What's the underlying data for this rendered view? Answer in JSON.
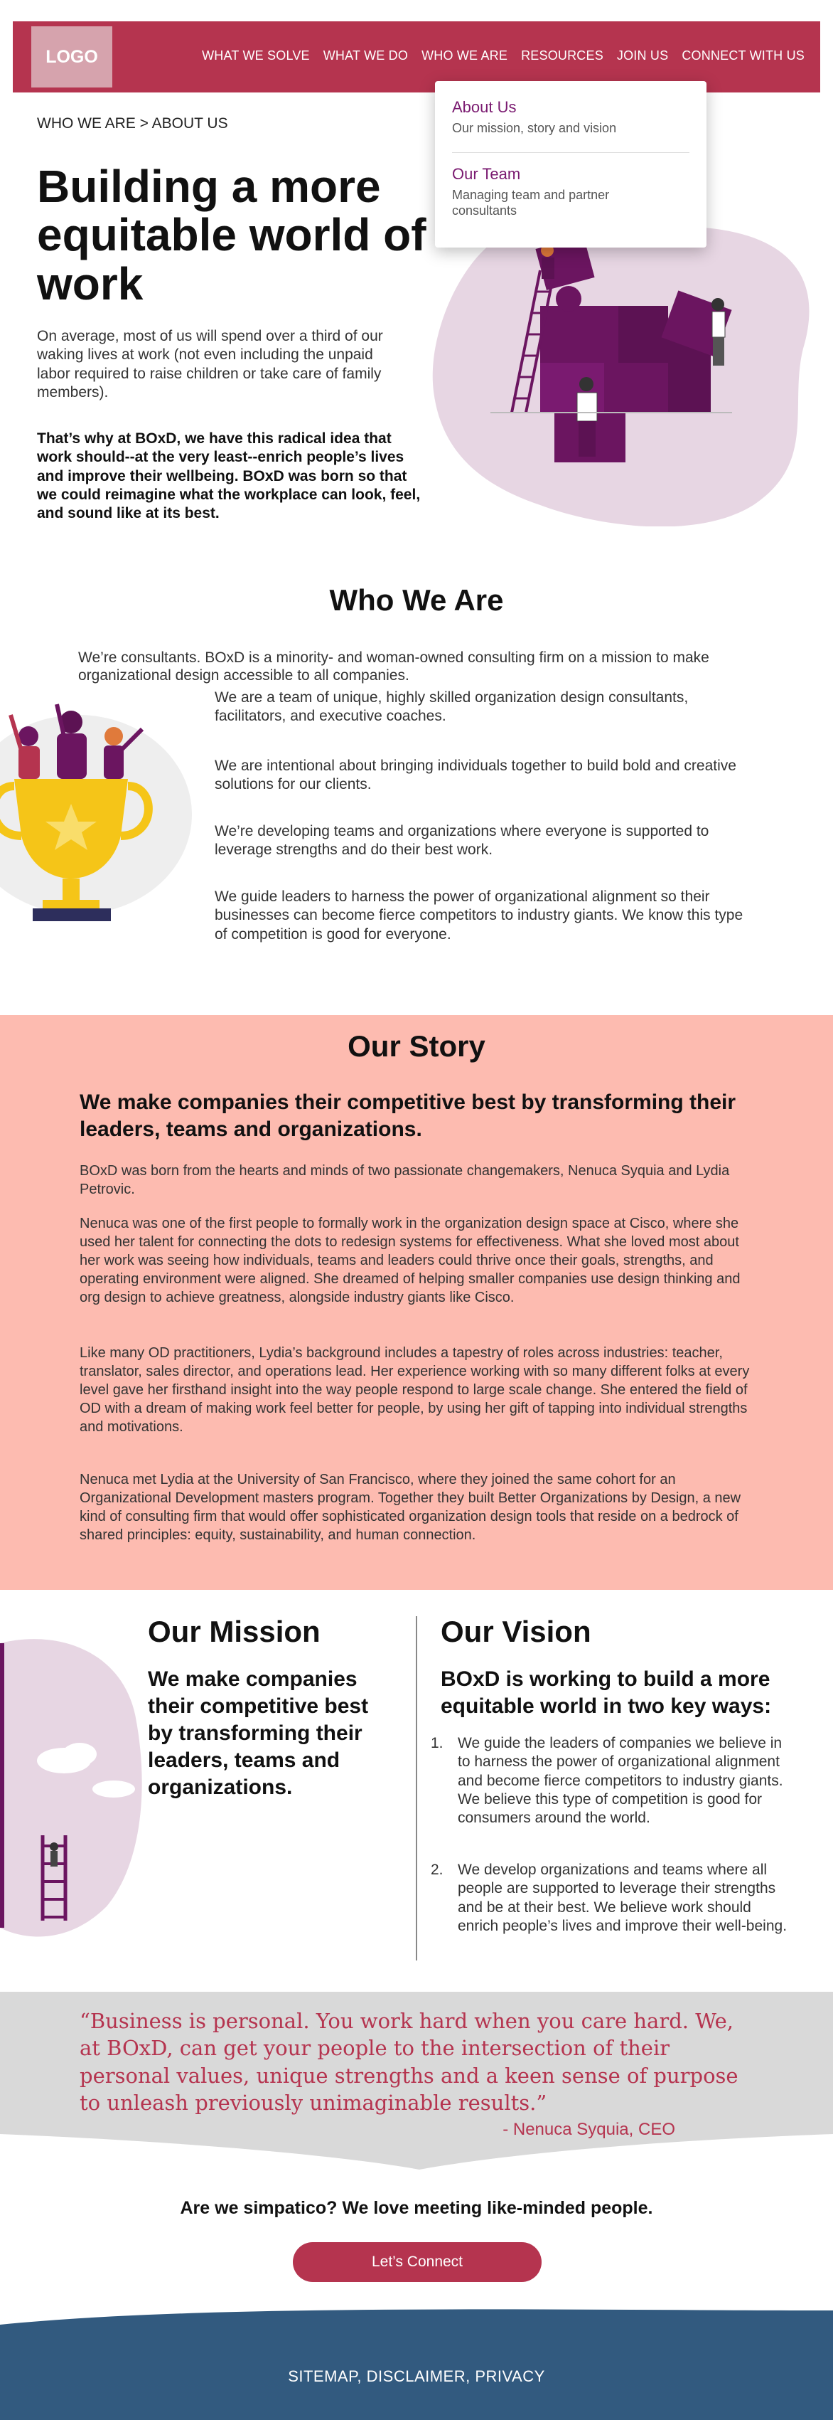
{
  "header": {
    "logo": "LOGO",
    "nav": [
      "WHAT WE SOLVE",
      "WHAT WE DO",
      "WHO WE ARE",
      "RESOURCES",
      "JOIN US",
      "CONNECT WITH US"
    ]
  },
  "dropdown": {
    "items": [
      {
        "title": "About Us",
        "desc": "Our mission, story and vision"
      },
      {
        "title": "Our Team",
        "desc": "Managing team and partner consultants"
      }
    ]
  },
  "breadcrumb": "WHO WE ARE > ABOUT US",
  "hero": {
    "title": "Building a more equitable world of work",
    "p1": "On average, most of us will spend over a third of our waking lives at work (not even including the unpaid labor required to raise children or take care of family members).",
    "p2": "That’s why at BOxD, we have this radical idea that work should--at the very least--enrich people’s lives and improve their wellbeing. BOxD was born so that we could reimagine what the workplace can look, feel, and sound like at its best."
  },
  "who": {
    "title": "Who We Are",
    "intro": "We’re consultants. BOxD is a minority- and woman-owned consulting firm on a mission to make organizational design accessible to all companies.",
    "paras": [
      "We are a team of unique, highly skilled organization design consultants, facilitators, and executive coaches.",
      "We are intentional about bringing individuals together to build bold and creative solutions for our clients.",
      "We’re developing teams and organizations where everyone is supported to leverage strengths and do their best work.",
      "We guide leaders to harness the power of organizational alignment so their businesses can become fierce competitors to industry giants. We know this type of competition is good for everyone."
    ]
  },
  "story": {
    "title": "Our Story",
    "subtitle": "We make companies their competitive best by transforming their leaders, teams and organizations.",
    "paras": [
      "BOxD was born from the hearts and minds of two passionate changemakers, Nenuca Syquia and Lydia Petrovic.",
      "Nenuca was one of the first people to formally work in the organization design space at Cisco, where she used her talent for connecting the dots to redesign systems for effectiveness. What she loved most about her work was seeing how individuals, teams and leaders could thrive once their goals, strengths, and operating environment were aligned. She dreamed of helping smaller companies use design thinking and org design to achieve greatness, alongside industry giants like Cisco.",
      "Like many OD practitioners, Lydia’s background includes a tapestry of roles across industries: teacher, translator, sales director, and operations lead. Her experience working with so many different folks at every level gave her firsthand insight into the way people respond to large scale change. She entered the field of OD with a dream of making work feel better for people, by using her gift of tapping into individual strengths and motivations.",
      "Nenuca met Lydia at the University of San Francisco, where they joined the same cohort for an Organizational Development masters program. Together they built Better Organizations by Design, a new kind of consulting firm that would offer sophisticated organization design tools that reside on a bedrock of shared principles: equity, sustainability, and human connection."
    ]
  },
  "mission": {
    "title": "Our Mission",
    "text": "We make companies their competitive best by transforming their leaders, teams and organizations."
  },
  "vision": {
    "title": "Our Vision",
    "subtitle": "BOxD is working to build a more equitable world in two key ways:",
    "items": [
      {
        "num": "1.",
        "text": "We guide the leaders of companies we believe in to harness the power of organizational alignment and become fierce competitors to industry giants. We believe this type of competition is good for consumers around the world."
      },
      {
        "num": "2.",
        "text": "We develop organizations and teams where all people are supported to leverage their strengths and be at their best. We believe work should enrich people’s lives and improve their well-being."
      }
    ]
  },
  "quote": {
    "text": "“Business is personal. You work hard when you care hard. We, at BOxD, can get your people to the intersection of their personal values, unique strengths and a keen sense of purpose to unleash previously unimaginable results.”",
    "author": "- Nenuca Syquia, CEO"
  },
  "cta": {
    "text": "Are we simpatico? We love meeting like-minded people.",
    "button": "Let’s Connect"
  },
  "footer": {
    "links": "SITEMAP, DISCLAIMER, PRIVACY"
  },
  "colors": {
    "brand": "#b5344f",
    "purple": "#6b1560",
    "story_bg": "#fdbbb0",
    "footer_bg": "#325a7f"
  }
}
